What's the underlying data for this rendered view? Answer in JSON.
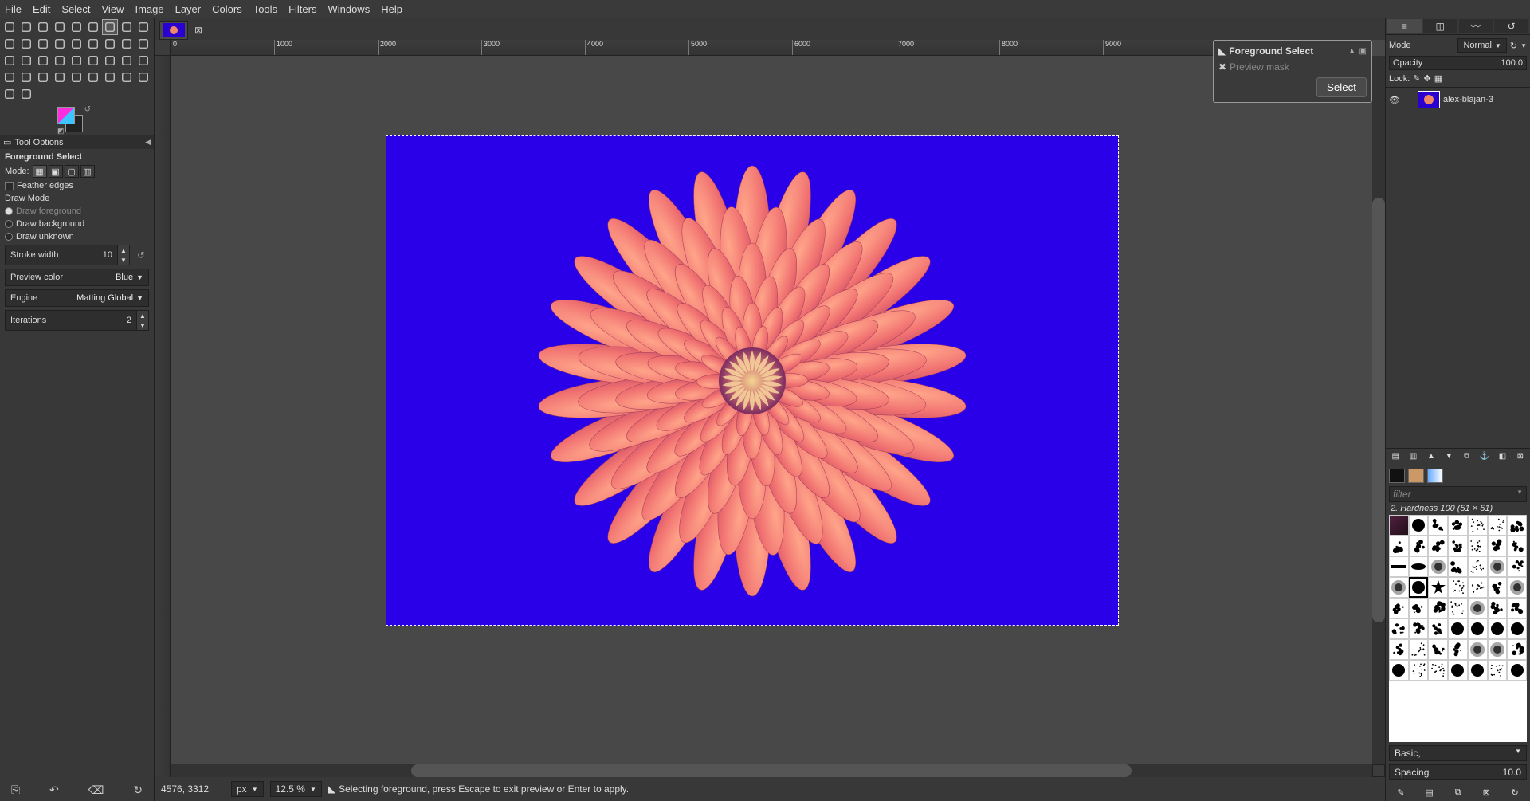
{
  "menubar": [
    "File",
    "Edit",
    "Select",
    "View",
    "Image",
    "Layer",
    "Colors",
    "Tools",
    "Filters",
    "Windows",
    "Help"
  ],
  "tool_options_panel": {
    "header": "Tool Options",
    "title": "Foreground Select",
    "mode_label": "Mode:",
    "feather_label": "Feather edges",
    "draw_mode_label": "Draw Mode",
    "draw_fg": "Draw foreground",
    "draw_bg": "Draw background",
    "draw_unknown": "Draw unknown",
    "stroke_label": "Stroke width",
    "stroke_value": "10",
    "preview_color_label": "Preview color",
    "preview_color_value": "Blue",
    "engine_label": "Engine",
    "engine_value": "Matting Global",
    "iterations_label": "Iterations",
    "iterations_value": "2"
  },
  "status": {
    "coords": "4576, 3312",
    "unit": "px",
    "zoom": "12.5 %",
    "message": "Selecting foreground, press Escape to exit preview or Enter to apply."
  },
  "popup": {
    "title": "Foreground Select",
    "preview_label": "Preview mask",
    "button": "Select"
  },
  "layers": {
    "mode_label": "Mode",
    "mode_value": "Normal",
    "opacity_label": "Opacity",
    "opacity_value": "100.0",
    "lock_label": "Lock:",
    "layer_name": "alex-blajan-3"
  },
  "brushes": {
    "filter_placeholder": "filter",
    "current": "2. Hardness 100 (51 × 51)",
    "group": "Basic,",
    "spacing_label": "Spacing",
    "spacing_value": "10.0"
  },
  "ruler_marks": [
    "0",
    "1000",
    "2000",
    "3000",
    "4000",
    "5000",
    "6000",
    "7000",
    "8000",
    "9000"
  ]
}
